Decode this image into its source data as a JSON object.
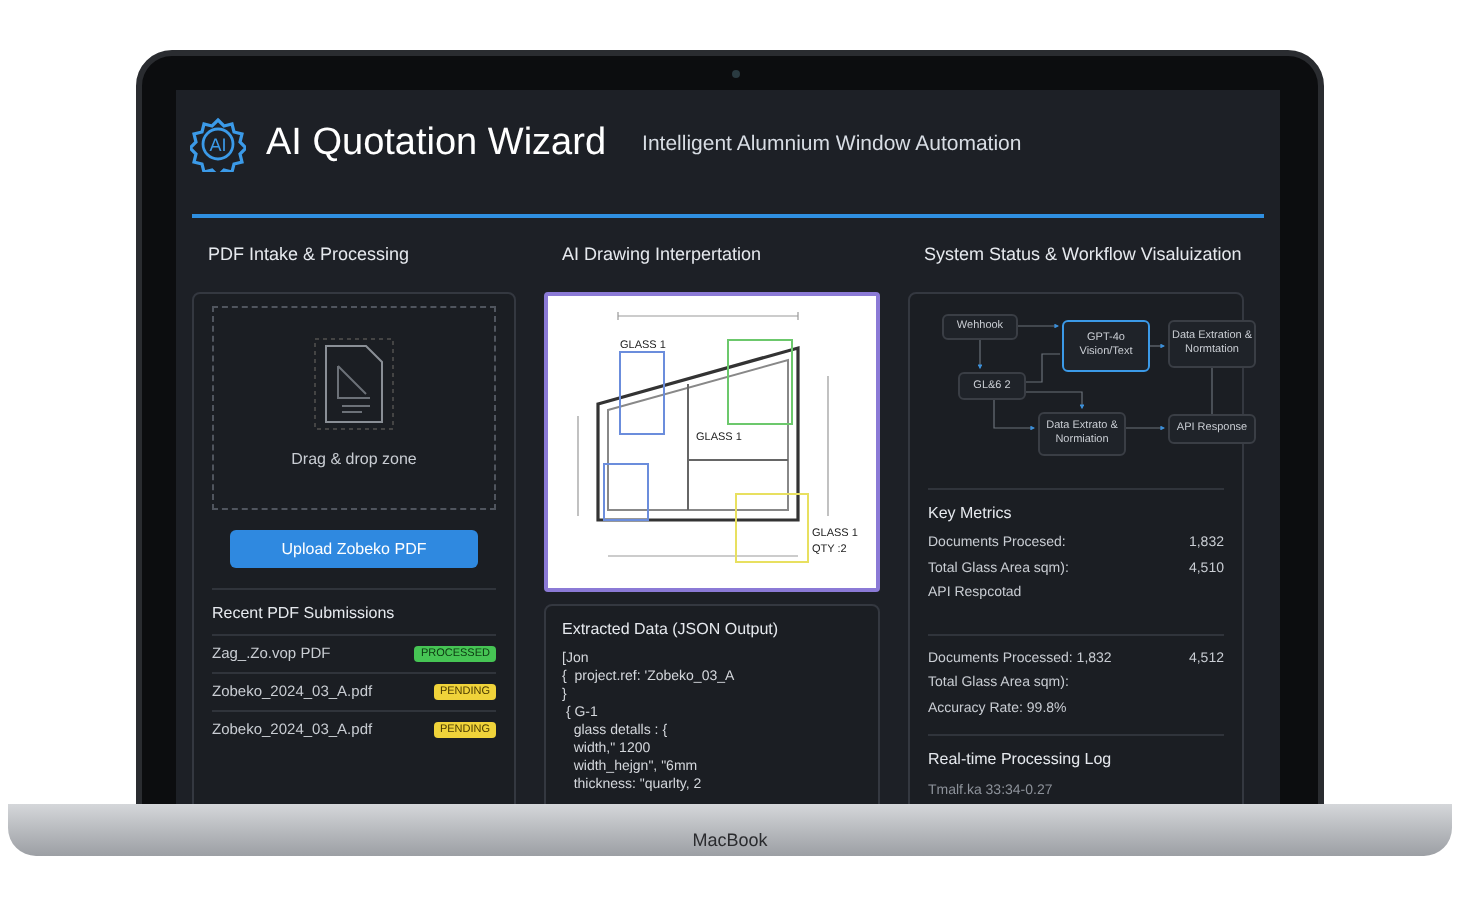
{
  "header": {
    "logo": "AI",
    "title": "AI Quotation Wizard",
    "subtitle": "Intelligent Alumnium Window Automation"
  },
  "intake": {
    "heading": "PDF Intake & Processing",
    "dropzone": "Drag & drop zone",
    "upload_button": "Upload Zobeko PDF",
    "recent_heading": "Recent PDF Submissions",
    "submissions": [
      {
        "name": "Zag_.Zo.vop PDF",
        "badge": "PROCESSED",
        "kind": "processed"
      },
      {
        "name": "Zobeko_2024_03_A.pdf",
        "badge": "PENDING",
        "kind": "pending"
      },
      {
        "name": "Zobeko_2024_03_A.pdf",
        "badge": "PENDING",
        "kind": "pending"
      }
    ]
  },
  "interpretation": {
    "heading": "AI Drawing Interpertation",
    "drawing_labels": [
      "GLASS 1",
      "GLASS 1",
      "GLASS 1",
      "QTY :2"
    ],
    "extracted": {
      "title": "Extracted Data (JSON Output)",
      "lines": [
        "[Jon",
        "{  project.ref: 'Zobeko_03_A",
        "}",
        " { G-1",
        "   glass detalls : {",
        "   width,\" 1200",
        "   width_hejgn\", \"6mm",
        "   thickness: \"quarlty, 2"
      ]
    }
  },
  "status": {
    "heading": "System Status & Workflow Visaluization",
    "workflow": [
      {
        "label": "Wehhook",
        "highlighted": false
      },
      {
        "label": "GPT-4o Vision/Text",
        "highlighted": true
      },
      {
        "label": "Data Extration & Normtation",
        "highlighted": false
      },
      {
        "label": "GL&6 2",
        "highlighted": false
      },
      {
        "label": "Data Extrato & Normiation",
        "highlighted": false
      },
      {
        "label": "API Response",
        "highlighted": false
      }
    ],
    "metrics_heading": "Key Metrics",
    "metrics": [
      {
        "label": "Documents Procesed:",
        "value": "1,832"
      },
      {
        "label": "Total Glass Area sqm):",
        "value": "4,510"
      },
      {
        "label": "API Respcotad"
      }
    ],
    "metrics_2": [
      {
        "label": "Documents Processed: 1,832",
        "value": "4,512"
      },
      {
        "label": "Total Glass Area sqm):"
      },
      {
        "label": "Accuracy Rate: 99.8%"
      }
    ],
    "log_heading": "Real-time Processing Log",
    "log": [
      "Tmalf.ka 33:34-0.27"
    ]
  },
  "laptop": {
    "brand": "MacBook"
  }
}
